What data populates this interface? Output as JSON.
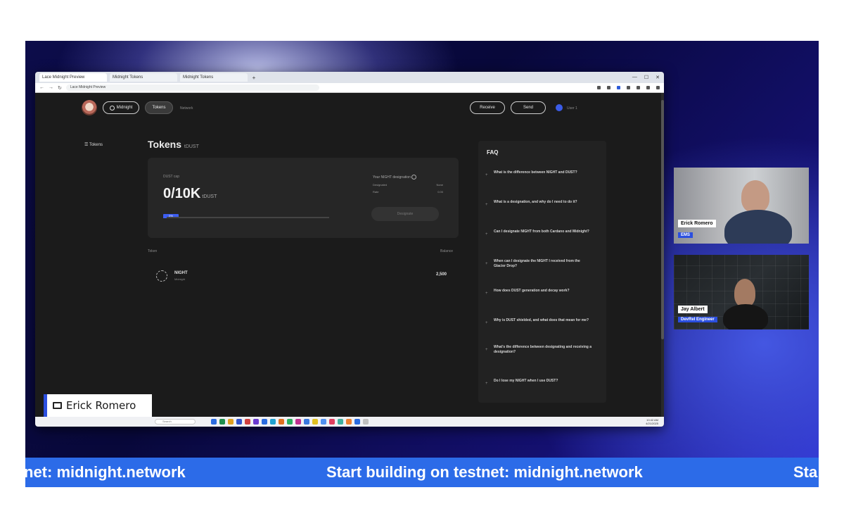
{
  "browser": {
    "tabs": [
      "Lace Midnight Preview",
      "Midnight Tokens",
      "Midnight Tokens"
    ],
    "url": "Lace Midnight Preview"
  },
  "app": {
    "brand_label": "Midnight",
    "nav_active": "Tokens",
    "nav_other": "Network",
    "header_buttons": [
      "Receive",
      "Send"
    ],
    "account_label": "User 1",
    "sidebar_item": "Tokens",
    "page_title": "Tokens",
    "page_title_suffix": "tDUST",
    "card": {
      "label": "DUST cap",
      "value": "0/10K",
      "unit": "tDUST",
      "progress_tag": "0%",
      "progress_fraction": 0.02,
      "right_title": "Your NIGHT designation",
      "rows": [
        {
          "k": "Designated",
          "v": "None"
        },
        {
          "k": "Rate",
          "v": "0.00"
        }
      ],
      "button_label": "Designate"
    },
    "table_headers": [
      "Token",
      "Balance"
    ],
    "token": {
      "name": "NIGHT",
      "sub": "Midnight",
      "balance": "2,500"
    },
    "faq": {
      "title": "FAQ",
      "items": [
        "What is the difference between NIGHT and DUST?",
        "What is a designation, and why do I need to do it?",
        "Can I designate NIGHT from both Cardano and Midnight?",
        "When can I designate the NIGHT I received from the Glacier Drop?",
        "How does DUST generation and decay work?",
        "Why is DUST shielded, and what does that mean for me?",
        "What's the difference between designating and receiving a designation?",
        "Do I lose my NIGHT when I use DUST?"
      ]
    }
  },
  "taskbar": {
    "search": "Search",
    "clock_time": "10:42 AM",
    "clock_date": "4/21/2025"
  },
  "presenter_tag": "Erick Romero",
  "participants": [
    {
      "name": "Erick Romero",
      "role": "EMS"
    },
    {
      "name": "Jay Albert",
      "role": "DevRel Engineer"
    }
  ],
  "ticker_text": "Start building on testnet: midnight.network",
  "ticker_left_fragment": "net: midnight.network",
  "ticker_right_fragment": "Sta"
}
